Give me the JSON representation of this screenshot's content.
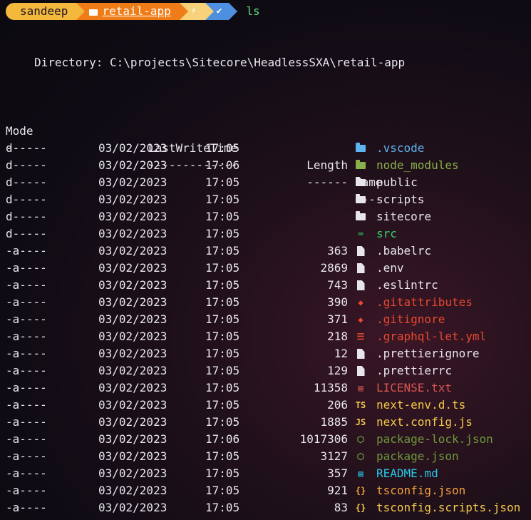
{
  "prompt": {
    "user": "sandeep",
    "folder": "retail-app",
    "bolt": "⚡",
    "check": "✔",
    "command": "ls",
    "colors": {
      "user": "#f3b83c",
      "path": "#f07c17",
      "bolt": "#f7d27b",
      "check": "#4e8fe0",
      "command": "#5ee07a"
    }
  },
  "directory_line": "Directory: C:\\projects\\Sitecore\\HeadlessSXA\\retail-app",
  "headers": {
    "mode": "Mode",
    "time": "LastWriteTime",
    "length": "Length",
    "name": "Name"
  },
  "dashes": {
    "mode": "----",
    "time": "-------------",
    "length": "------",
    "name": "----"
  },
  "rows": [
    {
      "mode": "d-----",
      "date": "03/02/2023",
      "time": "17:05",
      "length": "",
      "name": ".vscode",
      "color": "#5fb4f0",
      "icon": "vscode-folder-icon",
      "icon_glyph": "",
      "icon_color": "#5fb4f0"
    },
    {
      "mode": "d-----",
      "date": "03/02/2023",
      "time": "17:06",
      "length": "",
      "name": "node_modules",
      "color": "#8ab04a",
      "icon": "node-folder-icon",
      "icon_glyph": "",
      "icon_color": "#8ab04a"
    },
    {
      "mode": "d-----",
      "date": "03/02/2023",
      "time": "17:05",
      "length": "",
      "name": "public",
      "color": "#e8e6ec",
      "icon": "folder-icon",
      "icon_glyph": "",
      "icon_color": "#e8e6ec"
    },
    {
      "mode": "d-----",
      "date": "03/02/2023",
      "time": "17:05",
      "length": "",
      "name": "scripts",
      "color": "#e8e6ec",
      "icon": "folder-icon",
      "icon_glyph": "",
      "icon_color": "#e8e6ec"
    },
    {
      "mode": "d-----",
      "date": "03/02/2023",
      "time": "17:05",
      "length": "",
      "name": "sitecore",
      "color": "#e8e6ec",
      "icon": "folder-icon",
      "icon_glyph": "",
      "icon_color": "#e8e6ec"
    },
    {
      "mode": "d-----",
      "date": "03/02/2023",
      "time": "17:05",
      "length": "",
      "name": "src",
      "color": "#2fd36b",
      "icon": "terminal-icon",
      "icon_glyph": "⌨",
      "icon_color": "#2fd36b"
    },
    {
      "mode": "-a----",
      "date": "03/02/2023",
      "time": "17:05",
      "length": "363",
      "name": ".babelrc",
      "color": "#e8e6ec",
      "icon": "file-icon",
      "icon_glyph": "",
      "icon_color": "#e8e6ec"
    },
    {
      "mode": "-a----",
      "date": "03/02/2023",
      "time": "17:05",
      "length": "2869",
      "name": ".env",
      "color": "#e8e6ec",
      "icon": "file-icon",
      "icon_glyph": "",
      "icon_color": "#e8e6ec"
    },
    {
      "mode": "-a----",
      "date": "03/02/2023",
      "time": "17:05",
      "length": "743",
      "name": ".eslintrc",
      "color": "#e8e6ec",
      "icon": "file-icon",
      "icon_glyph": "",
      "icon_color": "#e8e6ec"
    },
    {
      "mode": "-a----",
      "date": "03/02/2023",
      "time": "17:05",
      "length": "390",
      "name": ".gitattributes",
      "color": "#e8492f",
      "icon": "git-icon",
      "icon_glyph": "◆",
      "icon_color": "#e8492f"
    },
    {
      "mode": "-a----",
      "date": "03/02/2023",
      "time": "17:05",
      "length": "371",
      "name": ".gitignore",
      "color": "#e8492f",
      "icon": "git-icon",
      "icon_glyph": "◆",
      "icon_color": "#e8492f"
    },
    {
      "mode": "-a----",
      "date": "03/02/2023",
      "time": "17:05",
      "length": "218",
      "name": ".graphql-let.yml",
      "color": "#e8492f",
      "icon": "yaml-icon",
      "icon_glyph": "☰",
      "icon_color": "#e8492f"
    },
    {
      "mode": "-a----",
      "date": "03/02/2023",
      "time": "17:05",
      "length": "12",
      "name": ".prettierignore",
      "color": "#e8e6ec",
      "icon": "file-icon",
      "icon_glyph": "",
      "icon_color": "#e8e6ec"
    },
    {
      "mode": "-a----",
      "date": "03/02/2023",
      "time": "17:05",
      "length": "129",
      "name": ".prettierrc",
      "color": "#e8e6ec",
      "icon": "file-icon",
      "icon_glyph": "",
      "icon_color": "#e8e6ec"
    },
    {
      "mode": "-a----",
      "date": "03/02/2023",
      "time": "17:05",
      "length": "11358",
      "name": "LICENSE.txt",
      "color": "#d9564e",
      "icon": "license-icon",
      "icon_glyph": "▤",
      "icon_color": "#d9564e"
    },
    {
      "mode": "-a----",
      "date": "03/02/2023",
      "time": "17:05",
      "length": "206",
      "name": "next-env.d.ts",
      "color": "#f3c94a",
      "icon": "typescript-icon",
      "icon_glyph": "TS",
      "icon_color": "#f3c94a"
    },
    {
      "mode": "-a----",
      "date": "03/02/2023",
      "time": "17:05",
      "length": "1885",
      "name": "next.config.js",
      "color": "#f3c94a",
      "icon": "javascript-icon",
      "icon_glyph": "JS",
      "icon_color": "#f3c94a"
    },
    {
      "mode": "-a----",
      "date": "03/02/2023",
      "time": "17:06",
      "length": "1017306",
      "name": "package-lock.json",
      "color": "#6e9a3a",
      "icon": "npm-icon",
      "icon_glyph": "⬡",
      "icon_color": "#6e9a3a"
    },
    {
      "mode": "-a----",
      "date": "03/02/2023",
      "time": "17:05",
      "length": "3127",
      "name": "package.json",
      "color": "#6e9a3a",
      "icon": "npm-icon",
      "icon_glyph": "⬡",
      "icon_color": "#6e9a3a"
    },
    {
      "mode": "-a----",
      "date": "03/02/2023",
      "time": "17:05",
      "length": "357",
      "name": "README.md",
      "color": "#29c7e6",
      "icon": "readme-icon",
      "icon_glyph": "▤",
      "icon_color": "#29c7e6"
    },
    {
      "mode": "-a----",
      "date": "03/02/2023",
      "time": "17:05",
      "length": "921",
      "name": "tsconfig.json",
      "color": "#f3a23a",
      "icon": "json-icon",
      "icon_glyph": "{}",
      "icon_color": "#f3a23a"
    },
    {
      "mode": "-a----",
      "date": "03/02/2023",
      "time": "17:05",
      "length": "83",
      "name": "tsconfig.scripts.json",
      "color": "#f3c94a",
      "icon": "json-icon",
      "icon_glyph": "{}",
      "icon_color": "#f3c94a"
    }
  ]
}
